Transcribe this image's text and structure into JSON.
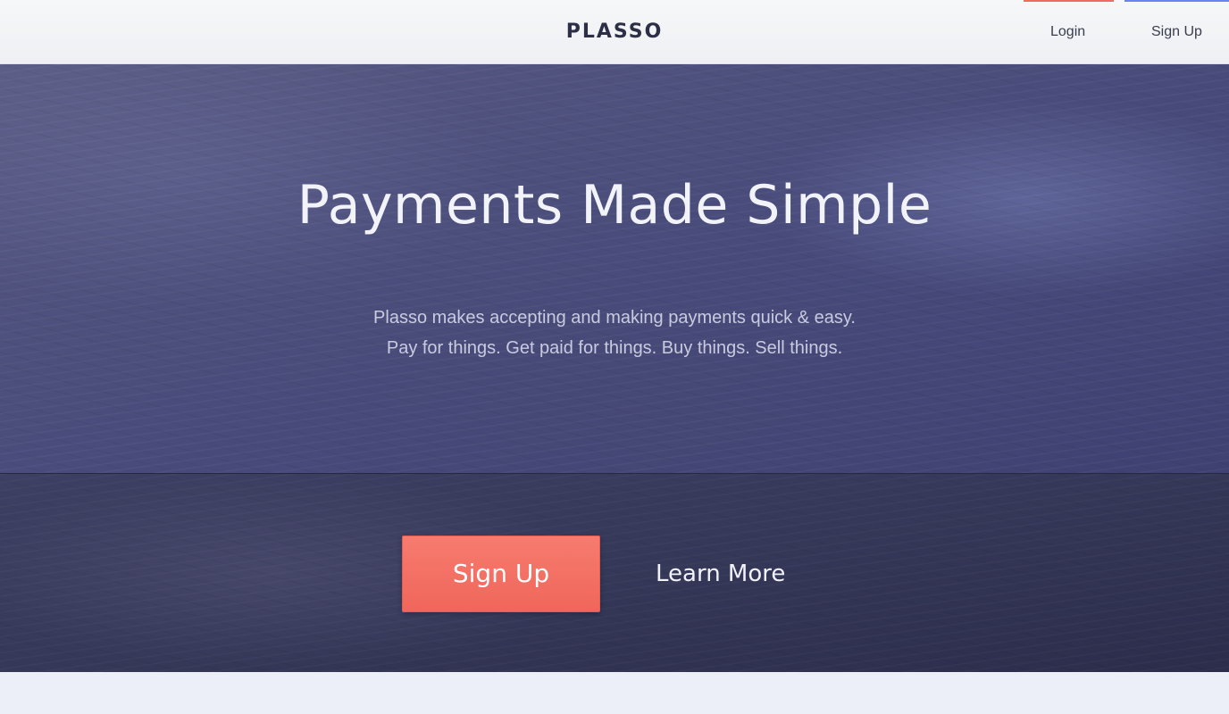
{
  "header": {
    "logo_text": "PLASSO",
    "nav": {
      "login_label": "Login",
      "signup_label": "Sign Up"
    },
    "accent_colors": {
      "login_indicator": "#f26b60",
      "signup_indicator": "#6a85f0"
    }
  },
  "hero": {
    "title": "Payments Made Simple",
    "subtitle_line1": "Plasso makes accepting and making payments quick & easy.",
    "subtitle_line2": "Pay for things. Get paid for things. Buy things. Sell things."
  },
  "cta": {
    "signup_label": "Sign Up",
    "learn_more_label": "Learn More",
    "signup_color": "#f26b60"
  }
}
